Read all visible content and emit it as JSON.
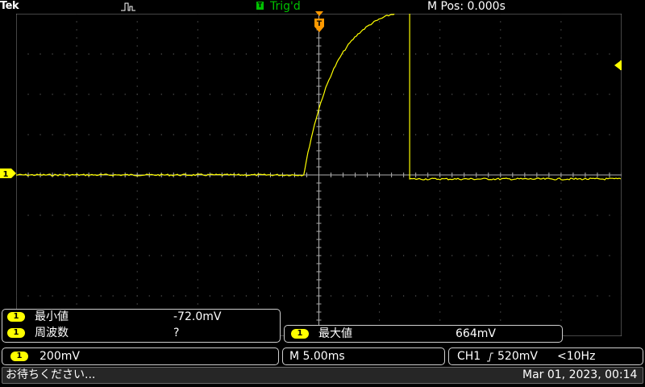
{
  "header": {
    "brand": "Tek",
    "acquisition_icon": "square-pulse-icon",
    "trigger_badge": "T",
    "trigger_status": "Trig'd",
    "m_pos": "M Pos: 0.000s"
  },
  "markers": {
    "channel_ground": "1"
  },
  "measurements": {
    "left": [
      {
        "channel": "1",
        "label": "最小値",
        "value": "-72.0mV"
      },
      {
        "channel": "1",
        "label": "周波数",
        "value": "?"
      }
    ],
    "right": {
      "channel": "1",
      "label": "最大値",
      "value": "664mV"
    }
  },
  "settings": {
    "channel": "1",
    "volts_per_div": "200mV",
    "timebase": "M 5.00ms",
    "trigger_source": "CH1",
    "trigger_slope_icon": "rising-edge-icon",
    "trigger_level": "520mV",
    "trigger_freq": "<10Hz"
  },
  "status": {
    "message": "お待ちください...",
    "datetime": "Mar 01, 2023, 00:14"
  },
  "colors": {
    "background": "#000000",
    "trace": "#ffff00",
    "trigger_marker": "#ff9900",
    "trig_status": "#00c000",
    "grid_dots": "#808080",
    "statusbar": "#262626"
  },
  "waveform": {
    "x_unit": "divisions",
    "y_unit": "divisions",
    "baseline_left": 0.0,
    "step_at_div": -0.25,
    "plateau": 4.17,
    "fall_at_div": 1.5,
    "baseline_right": -0.1
  }
}
